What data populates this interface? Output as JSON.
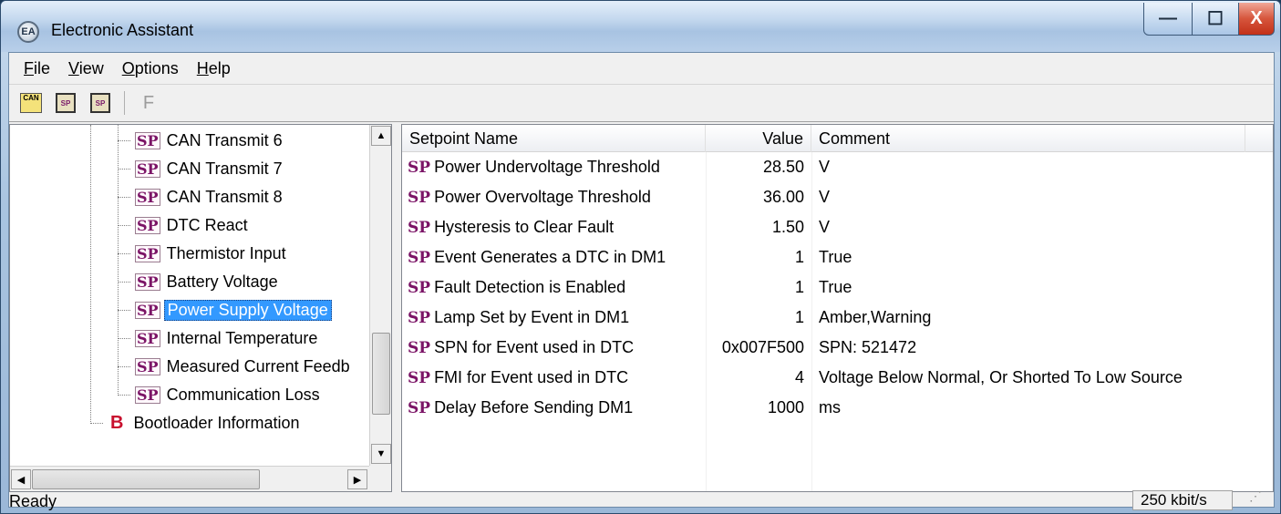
{
  "window": {
    "title": "Electronic Assistant",
    "icon_label": "EA"
  },
  "titlebar_buttons": {
    "minimize": "—",
    "maximize": "☐",
    "close": "X"
  },
  "menu": {
    "items": [
      {
        "label": "File",
        "accel": "F",
        "rest": "ile"
      },
      {
        "label": "View",
        "accel": "V",
        "rest": "iew"
      },
      {
        "label": "Options",
        "accel": "O",
        "rest": "ptions"
      },
      {
        "label": "Help",
        "accel": "H",
        "rest": "elp"
      }
    ]
  },
  "toolbar": {
    "can_label": "CAN",
    "sp_label": "SP",
    "f_label": "F"
  },
  "tree": {
    "items": [
      {
        "tag": "SP",
        "label": "CAN Transmit 6"
      },
      {
        "tag": "SP",
        "label": "CAN Transmit 7"
      },
      {
        "tag": "SP",
        "label": "CAN Transmit 8"
      },
      {
        "tag": "SP",
        "label": "DTC React"
      },
      {
        "tag": "SP",
        "label": "Thermistor Input"
      },
      {
        "tag": "SP",
        "label": "Battery Voltage"
      },
      {
        "tag": "SP",
        "label": "Power Supply Voltage"
      },
      {
        "tag": "SP",
        "label": "Internal Temperature"
      },
      {
        "tag": "SP",
        "label": "Measured Current Feedb"
      },
      {
        "tag": "SP",
        "label": "Communication Loss"
      },
      {
        "tag": "B",
        "label": "Bootloader Information"
      }
    ],
    "selected_index": 6
  },
  "list": {
    "headers": {
      "name": "Setpoint Name",
      "value": "Value",
      "comment": "Comment"
    },
    "rows": [
      {
        "tag": "SP",
        "name": "Power Undervoltage Threshold",
        "value": "28.50",
        "comment": "V"
      },
      {
        "tag": "SP",
        "name": "Power Overvoltage Threshold",
        "value": "36.00",
        "comment": "V"
      },
      {
        "tag": "SP",
        "name": "Hysteresis to Clear Fault",
        "value": "1.50",
        "comment": "V"
      },
      {
        "tag": "SP",
        "name": "Event Generates a DTC in DM1",
        "value": "1",
        "comment": "True"
      },
      {
        "tag": "SP",
        "name": "Fault Detection is Enabled",
        "value": "1",
        "comment": "True"
      },
      {
        "tag": "SP",
        "name": "Lamp Set by Event in DM1",
        "value": "1",
        "comment": "Amber,Warning"
      },
      {
        "tag": "SP",
        "name": "SPN for Event used in DTC",
        "value": "0x007F500",
        "comment": "SPN: 521472"
      },
      {
        "tag": "SP",
        "name": "FMI for Event used in DTC",
        "value": "4",
        "comment": "Voltage Below Normal, Or Shorted To Low Source"
      },
      {
        "tag": "SP",
        "name": "Delay Before Sending DM1",
        "value": "1000",
        "comment": "ms"
      }
    ]
  },
  "status": {
    "text": "Ready",
    "baud": "250 kbit/s"
  }
}
